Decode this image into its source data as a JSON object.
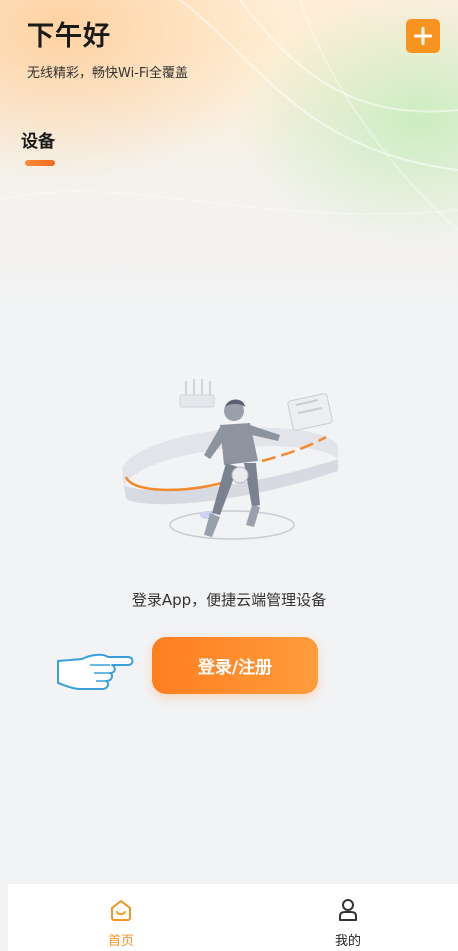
{
  "header": {
    "greeting": "下午好",
    "subtitle": "无线精彩，畅快Wi-Fi全覆盖",
    "add_icon": "plus-icon",
    "accent_color": "#f7931e"
  },
  "section": {
    "tab_label": "设备"
  },
  "empty_state": {
    "illustration": "person-with-devices-illustration",
    "prompt": "登录App，便捷云端管理设备",
    "login_button_label": "登录/注册"
  },
  "tabbar": {
    "items": [
      {
        "label": "首页",
        "icon": "home-icon",
        "active": true
      },
      {
        "label": "我的",
        "icon": "user-icon",
        "active": false
      }
    ]
  }
}
